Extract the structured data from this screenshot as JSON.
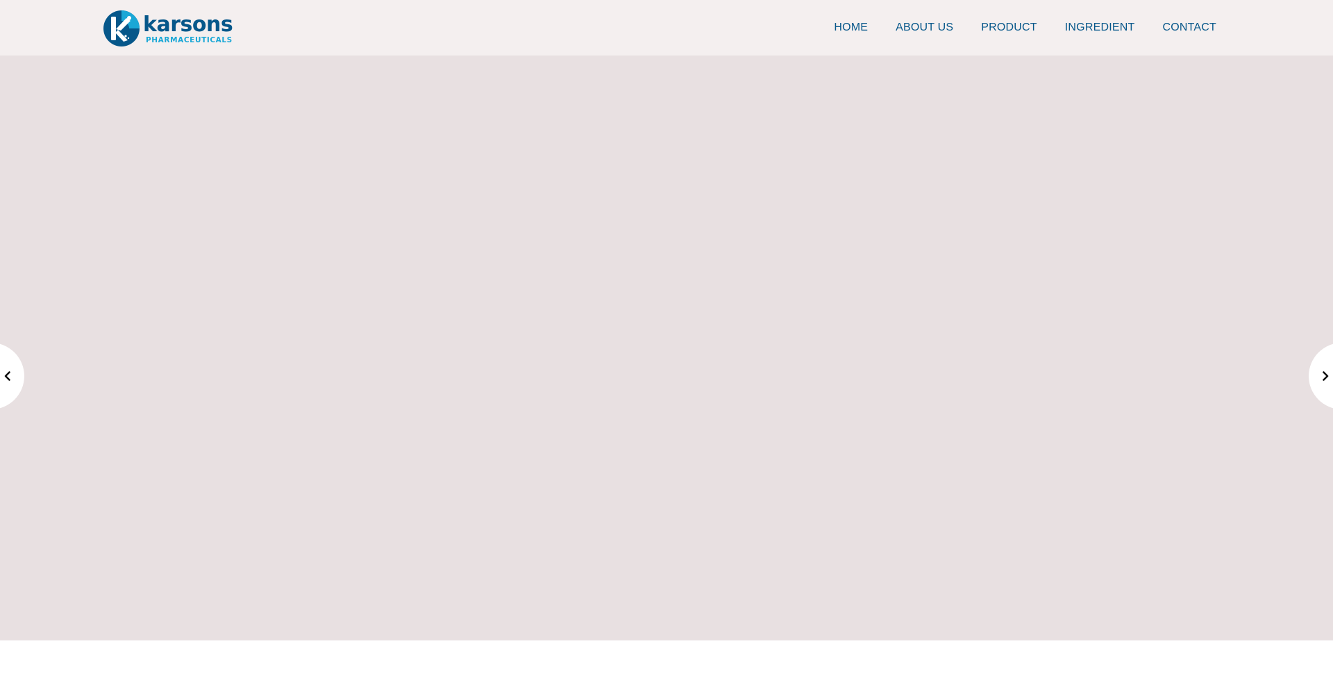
{
  "brand": {
    "name": "karsons",
    "tagline": "PHARMACEUTICALS",
    "colors": {
      "primary": "#06578a",
      "accent": "#1aa7d6"
    }
  },
  "nav": {
    "items": [
      {
        "label": "HOME"
      },
      {
        "label": "ABOUT US"
      },
      {
        "label": "PRODUCT"
      },
      {
        "label": "INGREDIENT"
      },
      {
        "label": "CONTACT"
      }
    ]
  },
  "slider": {
    "prev_icon": "chevron-left-icon",
    "next_icon": "chevron-right-icon"
  },
  "colors": {
    "header_bg": "#f4efef",
    "hero_bg": "#e8e0e1",
    "nav_text": "#06578a"
  }
}
